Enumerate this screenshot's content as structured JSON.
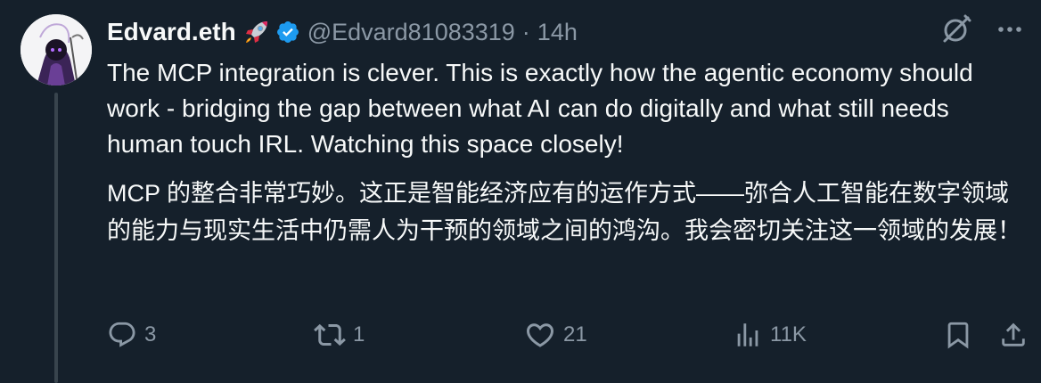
{
  "user": {
    "display_name": "Edvard.eth",
    "emoji_icon": "rocket-emoji",
    "verified_icon": "verified-badge-icon",
    "handle": "@Edvard81083319",
    "separator": "·",
    "time": "14h"
  },
  "header_icons": [
    "grok-icon",
    "more-icon"
  ],
  "tweet": {
    "text_en": "The MCP integration is clever. This is exactly how the agentic economy should work - bridging the gap between what AI can do digitally and what still needs human touch IRL. Watching this space closely!",
    "text_zh": "MCP 的整合非常巧妙。这正是智能经济应有的运作方式——弥合人工智能在数字领域的能力与现实生活中仍需人为干预的领域之间的鸿沟。我会密切关注这一领域的发展！"
  },
  "actions": {
    "reply": {
      "icon": "reply-icon",
      "count": "3"
    },
    "retweet": {
      "icon": "retweet-icon",
      "count": "1"
    },
    "like": {
      "icon": "heart-icon",
      "count": "21"
    },
    "views": {
      "icon": "views-icon",
      "count": "11K"
    },
    "bookmark": {
      "icon": "bookmark-icon"
    },
    "share": {
      "icon": "share-icon"
    }
  },
  "colors": {
    "background": "#15202b",
    "primary_text": "#f7f9f9",
    "secondary_text": "#8b98a5",
    "verified": "#1d9bf0",
    "thread_line": "#38444d"
  }
}
